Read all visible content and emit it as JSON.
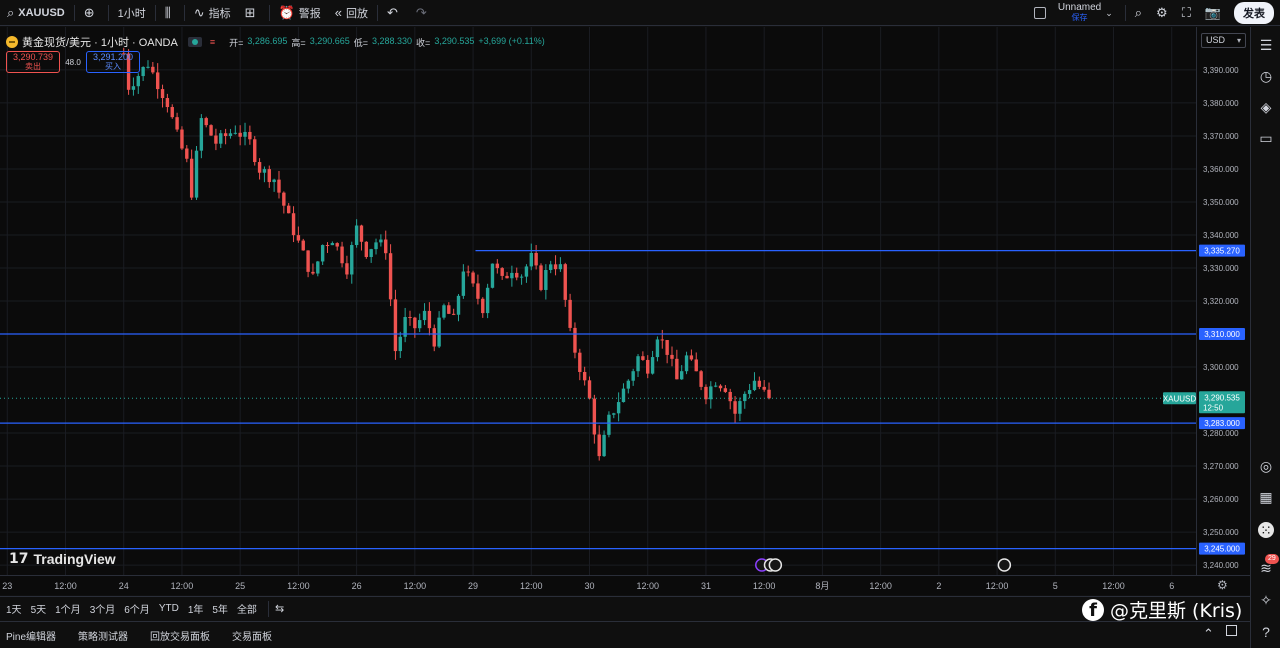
{
  "toolbar": {
    "symbol": "XAUUSD",
    "interval": "1小时",
    "indicators_label": "指标",
    "alert_label": "警报",
    "replay_label": "回放",
    "layout_name": "Unnamed",
    "layout_status": "保存",
    "publish_label": "发表"
  },
  "legend": {
    "title": "黄金现货/美元 · 1小时 · OANDA",
    "open_label": "开=",
    "open_value": "3,286.695",
    "high_label": "高=",
    "high_value": "3,290.665",
    "low_label": "低=",
    "low_value": "3,288.330",
    "close_label": "收=",
    "close_value": "3,290.535",
    "change": "+3,699 (+0.11%)"
  },
  "trade": {
    "sell_price": "3,290.739",
    "sell_label": "卖出",
    "spread": "48.0",
    "buy_price": "3,291.200",
    "buy_label": "买入"
  },
  "currency": "USD",
  "price_scale": {
    "ticks": [
      {
        "value": 3390,
        "label": "3,390.000"
      },
      {
        "value": 3380,
        "label": "3,380.000"
      },
      {
        "value": 3370,
        "label": "3,370.000"
      },
      {
        "value": 3360,
        "label": "3,360.000"
      },
      {
        "value": 3350,
        "label": "3,350.000"
      },
      {
        "value": 3340,
        "label": "3,340.000"
      },
      {
        "value": 3330,
        "label": "3,330.000"
      },
      {
        "value": 3320,
        "label": "3,320.000"
      },
      {
        "value": 3300,
        "label": "3,300.000"
      },
      {
        "value": 3280,
        "label": "3,280.000"
      },
      {
        "value": 3270,
        "label": "3,270.000"
      },
      {
        "value": 3260,
        "label": "3,260.000"
      },
      {
        "value": 3250,
        "label": "3,250.000"
      },
      {
        "value": 3240,
        "label": "3,240.000"
      }
    ]
  },
  "horizontal_lines": [
    {
      "value": 3335.27,
      "label": "3,335.270",
      "partial": true
    },
    {
      "value": 3310.0,
      "label": "3,310.000",
      "partial": false
    },
    {
      "value": 3283.0,
      "label": "3,283.000",
      "partial": false
    },
    {
      "value": 3245.0,
      "label": "3,245.000",
      "partial": false
    }
  ],
  "current_price": {
    "symbol": "XAUUSD",
    "value": 3290.535,
    "label": "3,290.535",
    "countdown": "12:50"
  },
  "time_scale": {
    "labels": [
      {
        "t": 0,
        "label": "23"
      },
      {
        "t": 12,
        "label": "12:00"
      },
      {
        "t": 24,
        "label": "24"
      },
      {
        "t": 36,
        "label": "12:00"
      },
      {
        "t": 48,
        "label": "25"
      },
      {
        "t": 60,
        "label": "12:00"
      },
      {
        "t": 72,
        "label": "26"
      },
      {
        "t": 84,
        "label": "12:00"
      },
      {
        "t": 96,
        "label": "29"
      },
      {
        "t": 108,
        "label": "12:00"
      },
      {
        "t": 120,
        "label": "30"
      },
      {
        "t": 132,
        "label": "12:00"
      },
      {
        "t": 144,
        "label": "31"
      },
      {
        "t": 156,
        "label": "12:00"
      },
      {
        "t": 168,
        "label": "8月"
      },
      {
        "t": 180,
        "label": "12:00"
      },
      {
        "t": 192,
        "label": "2"
      },
      {
        "t": 204,
        "label": "12:00"
      },
      {
        "t": 216,
        "label": "5"
      },
      {
        "t": 228,
        "label": "12:00"
      },
      {
        "t": 240,
        "label": "6"
      }
    ]
  },
  "range_buttons": [
    "1天",
    "5天",
    "1个月",
    "3个月",
    "6个月",
    "YTD",
    "1年",
    "5年",
    "全部"
  ],
  "panel_tabs": [
    "Pine编辑器",
    "策略测试器",
    "回放交易面板",
    "交易面板"
  ],
  "brand": "TradingView",
  "watermark": "@克里斯 (Kris)",
  "notifications_count": "29",
  "colors": {
    "up": "#26a69a",
    "down": "#ef5350",
    "line": "#2962ff",
    "background": "#0b0b0b"
  },
  "chart_data": {
    "type": "candlestick",
    "symbol": "XAUUSD",
    "interval": "1h",
    "ylim": [
      3237,
      3403
    ],
    "xlim_hours": [
      -1.5,
      245
    ],
    "waypoints": [
      {
        "t": 24,
        "price": 3395
      },
      {
        "t": 25,
        "price": 3385
      },
      {
        "t": 29,
        "price": 3392
      },
      {
        "t": 33,
        "price": 3380
      },
      {
        "t": 35,
        "price": 3370
      },
      {
        "t": 37,
        "price": 3362
      },
      {
        "t": 38,
        "price": 3353
      },
      {
        "t": 40,
        "price": 3375
      },
      {
        "t": 43,
        "price": 3368
      },
      {
        "t": 47,
        "price": 3372
      },
      {
        "t": 50,
        "price": 3368
      },
      {
        "t": 52,
        "price": 3360
      },
      {
        "t": 55,
        "price": 3357
      },
      {
        "t": 58,
        "price": 3345
      },
      {
        "t": 61,
        "price": 3334
      },
      {
        "t": 63,
        "price": 3327
      },
      {
        "t": 65,
        "price": 3337
      },
      {
        "t": 67,
        "price": 3339
      },
      {
        "t": 70,
        "price": 3330
      },
      {
        "t": 72,
        "price": 3342
      },
      {
        "t": 74,
        "price": 3335
      },
      {
        "t": 76,
        "price": 3338
      },
      {
        "t": 78,
        "price": 3336
      },
      {
        "t": 80,
        "price": 3305
      },
      {
        "t": 82,
        "price": 3314
      },
      {
        "t": 84,
        "price": 3312
      },
      {
        "t": 86,
        "price": 3316
      },
      {
        "t": 88,
        "price": 3308
      },
      {
        "t": 90,
        "price": 3318
      },
      {
        "t": 92,
        "price": 3314
      },
      {
        "t": 94,
        "price": 3330
      },
      {
        "t": 96,
        "price": 3324
      },
      {
        "t": 98,
        "price": 3318
      },
      {
        "t": 100,
        "price": 3332
      },
      {
        "t": 102,
        "price": 3326
      },
      {
        "t": 104,
        "price": 3330
      },
      {
        "t": 106,
        "price": 3328
      },
      {
        "t": 108,
        "price": 3333
      },
      {
        "t": 110,
        "price": 3325
      },
      {
        "t": 112,
        "price": 3332
      },
      {
        "t": 114,
        "price": 3330
      },
      {
        "t": 116,
        "price": 3310
      },
      {
        "t": 118,
        "price": 3300
      },
      {
        "t": 120,
        "price": 3290
      },
      {
        "t": 122,
        "price": 3272
      },
      {
        "t": 124,
        "price": 3284
      },
      {
        "t": 126,
        "price": 3290
      },
      {
        "t": 128,
        "price": 3296
      },
      {
        "t": 130,
        "price": 3303
      },
      {
        "t": 132,
        "price": 3300
      },
      {
        "t": 134,
        "price": 3310
      },
      {
        "t": 136,
        "price": 3305
      },
      {
        "t": 138,
        "price": 3296
      },
      {
        "t": 140,
        "price": 3303
      },
      {
        "t": 142,
        "price": 3298
      },
      {
        "t": 144,
        "price": 3292
      },
      {
        "t": 146,
        "price": 3296
      },
      {
        "t": 148,
        "price": 3294
      },
      {
        "t": 150,
        "price": 3286
      },
      {
        "t": 152,
        "price": 3292
      },
      {
        "t": 154,
        "price": 3296
      },
      {
        "t": 156,
        "price": 3292
      },
      {
        "t": 157,
        "price": 3290.5
      }
    ],
    "last_close": 3290.535
  }
}
